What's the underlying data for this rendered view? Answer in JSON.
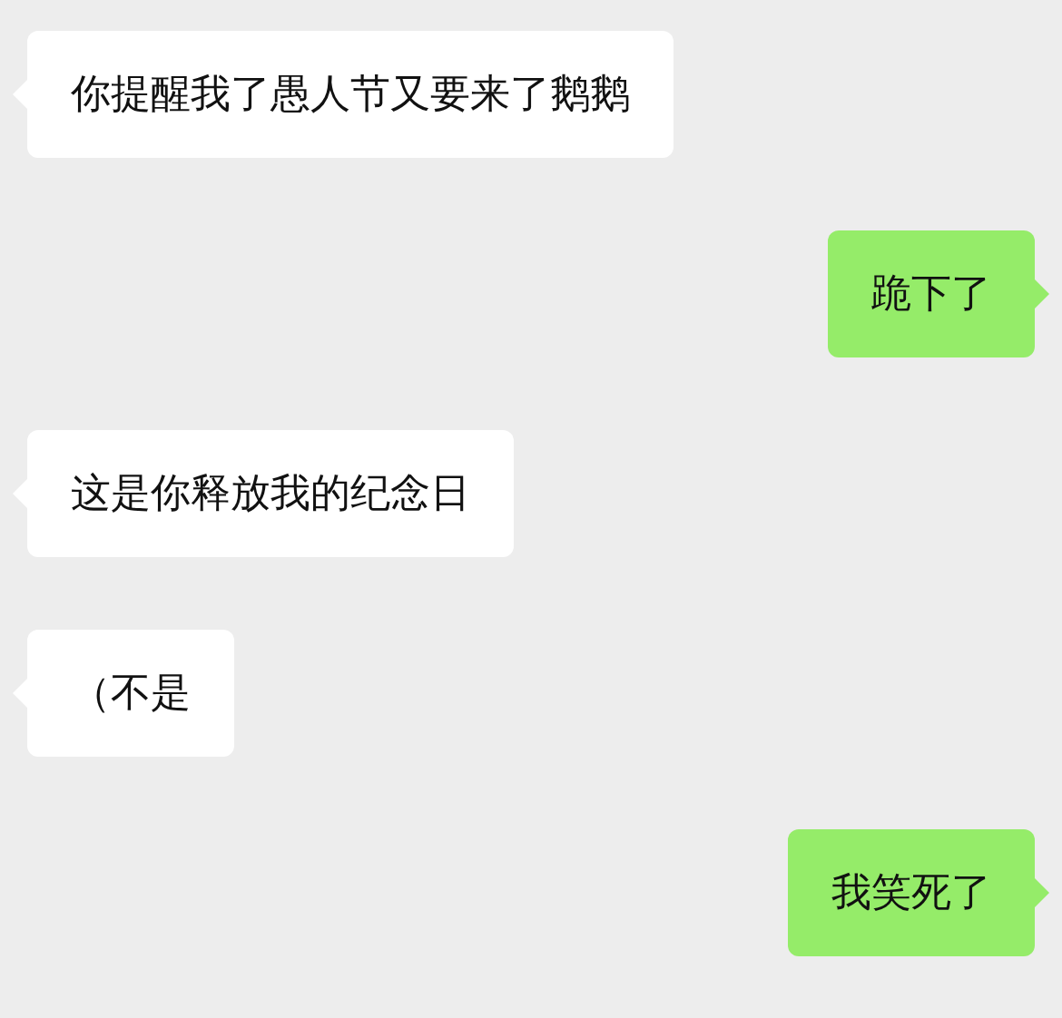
{
  "messages": [
    {
      "text": "你提醒我了愚人节又要来了鹅鹅",
      "outgoing": false
    },
    {
      "text": "跪下了",
      "outgoing": true
    },
    {
      "text": "这是你释放我的纪念日",
      "outgoing": false
    },
    {
      "text": "（不是",
      "outgoing": false
    },
    {
      "text": "我笑死了",
      "outgoing": true
    }
  ]
}
